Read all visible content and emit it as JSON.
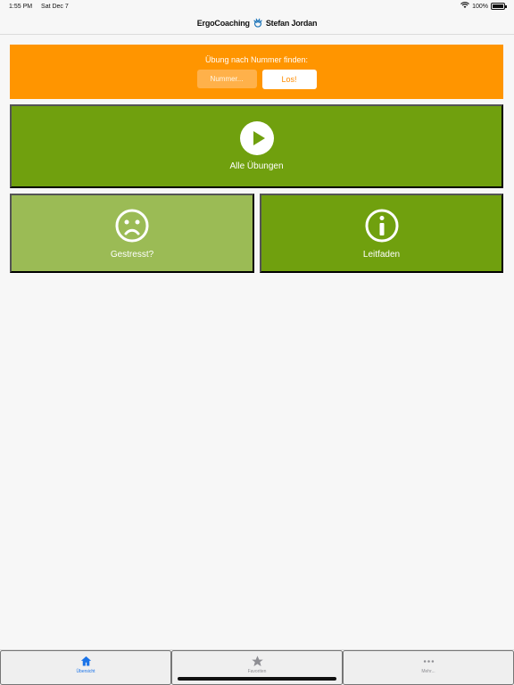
{
  "status": {
    "time": "1:55 PM",
    "date": "Sat Dec 7",
    "battery": "100%"
  },
  "header": {
    "brand_left": "ErgoCoaching",
    "brand_right": "Stefan Jordan"
  },
  "search": {
    "label": "Übung nach Nummer finden:",
    "placeholder": "Nummer...",
    "button_label": "Los!"
  },
  "tiles": {
    "all": "Alle Übungen",
    "stressed": "Gestresst?",
    "guide": "Leitfaden"
  },
  "tabs": [
    {
      "label": "Übersicht",
      "icon": "home-icon",
      "active": true
    },
    {
      "label": "Favoriten",
      "icon": "star-icon",
      "active": false
    },
    {
      "label": "Mehr...",
      "icon": "more-icon",
      "active": false
    }
  ],
  "colors": {
    "orange": "#ff9500",
    "green": "#70a00e",
    "light_green": "#9bbb55",
    "active_blue": "#1a73e8"
  }
}
